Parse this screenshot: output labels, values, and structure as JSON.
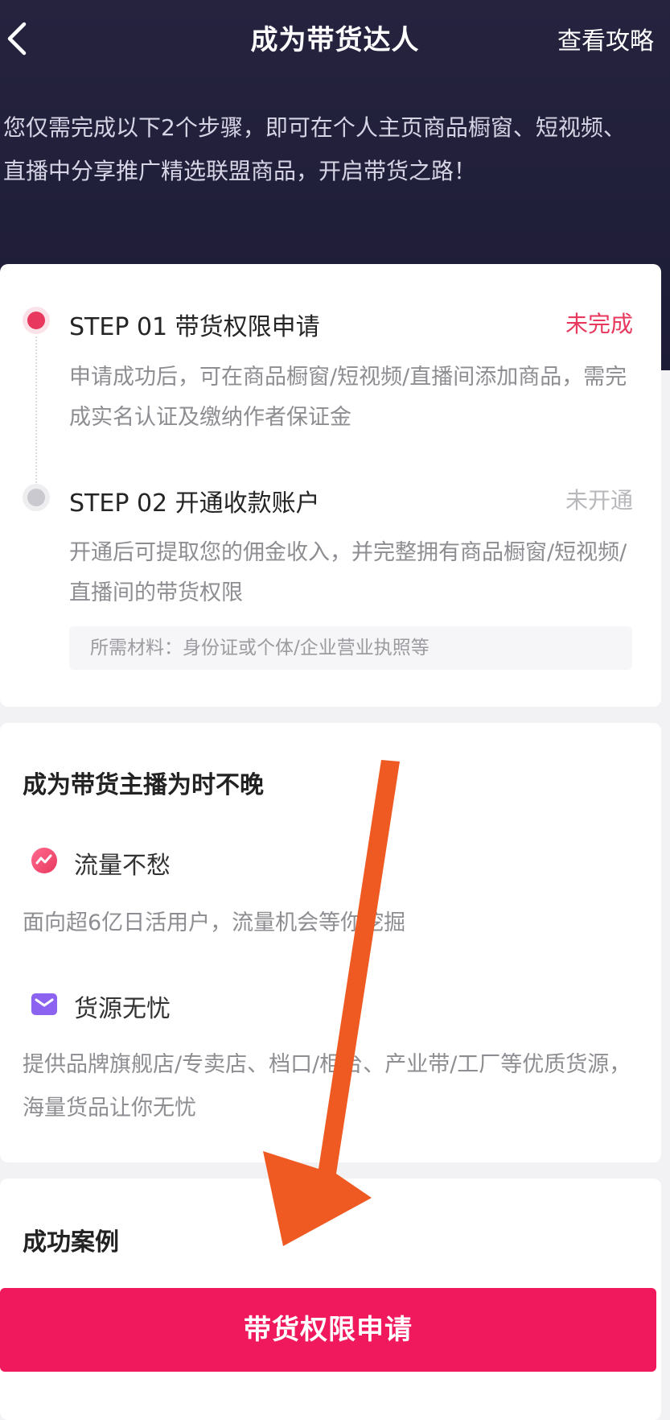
{
  "nav": {
    "title": "成为带货达人",
    "guide_label": "查看攻略"
  },
  "intro": {
    "text": "您仅需完成以下2个步骤，即可在个人主页商品橱窗、短视频、直播中分享推广精选联盟商品，开启带货之路！"
  },
  "steps": [
    {
      "title": "STEP 01 带货权限申请",
      "status": "未完成",
      "desc": "申请成功后，可在商品橱窗/短视频/直播间添加商品，需完成实名认证及缴纳作者保证金"
    },
    {
      "title": "STEP 02 开通收款账户",
      "status": "未开通",
      "desc": "开通后可提取您的佣金收入，并完整拥有商品橱窗/短视频/直播间的带货权限",
      "materials": "所需材料：身份证或个体/企业营业执照等"
    }
  ],
  "benefits": {
    "title": "成为带货主播为时不晚",
    "items": [
      {
        "icon": "traffic-icon",
        "title": "流量不愁",
        "desc": "面向超6亿日活用户，流量机会等你挖掘"
      },
      {
        "icon": "goods-box-icon",
        "title": "货源无忧",
        "desc": "提供品牌旗舰店/专卖店、档口/柜台、产业带/工厂等优质货源，海量货品让你无忧"
      }
    ]
  },
  "cases": {
    "title": "成功案例"
  },
  "apply_button": {
    "label": "带货权限申请"
  },
  "colors": {
    "accent": "#f0195d",
    "hero_bg": "#1d1c36",
    "arrow": "#ef5a22"
  }
}
